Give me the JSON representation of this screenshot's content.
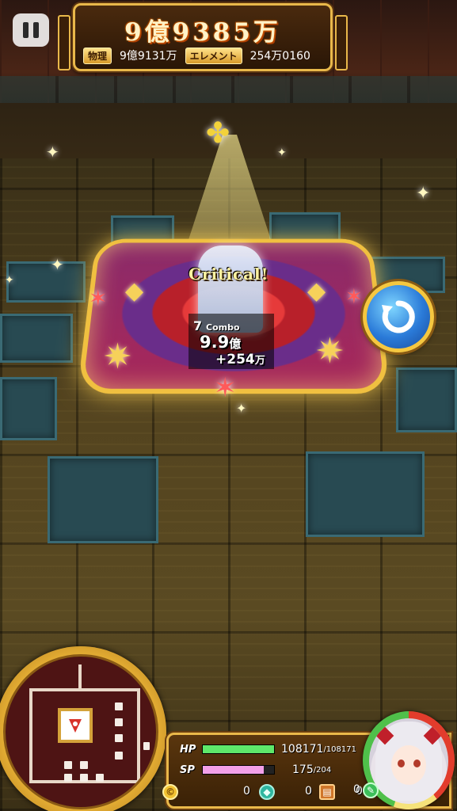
{
  "score": {
    "total": "9億9385万",
    "physical_label": "物理",
    "physical_value": "9億9131万",
    "element_label": "エレメント",
    "element_value": "254万0160"
  },
  "popup": {
    "critical": "Critical!",
    "combo_count": "7",
    "combo_label": "Combo",
    "damage_main_num": "9.9",
    "damage_main_unit": "億",
    "damage_sub_num": "+254",
    "damage_sub_unit": "万"
  },
  "status": {
    "hp_label": "HP",
    "hp_current": "108171",
    "hp_max": "/108171",
    "hp_fraction": 1.0,
    "sp_label": "SP",
    "sp_current": "175",
    "sp_max": "/204",
    "sp_fraction": 0.86,
    "coins": "0",
    "gems": "0",
    "chests": "0",
    "keys": "0"
  },
  "colors": {
    "hp_bar": "#5ee86a",
    "sp_bar": "#f2a0e8",
    "gold_frame": "#e9b84a"
  },
  "icons": {
    "pause": "pause-icon",
    "rotate": "rotate-camera-icon",
    "coin": "coin-icon",
    "gem": "gem-icon",
    "chest": "chest-icon",
    "key": "key-icon"
  }
}
